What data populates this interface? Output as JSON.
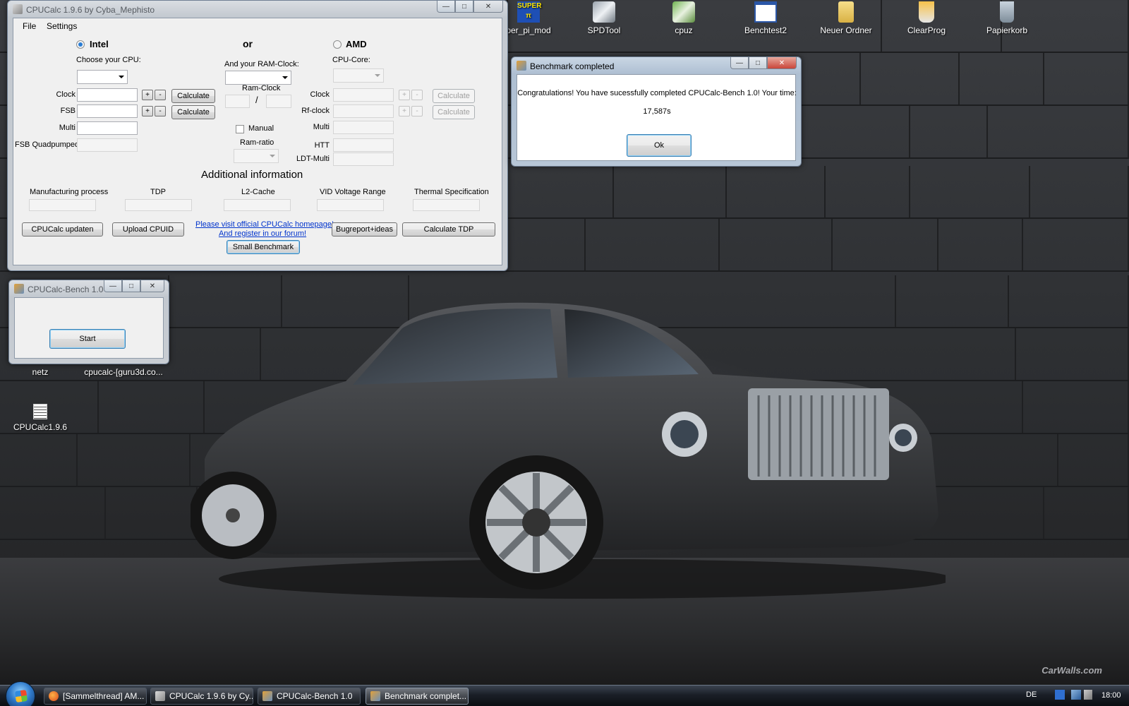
{
  "desktop": {
    "icons_top": [
      "per_pi_mod",
      "SPDTool",
      "cpuz",
      "Benchtest2",
      "Neuer Ordner",
      "ClearProg",
      "Papierkorb"
    ],
    "icons_left": [
      "netz",
      "cpucalc-[guru3d.co...",
      "CPUCalc1.9.6"
    ],
    "watermark": "CarWalls.com"
  },
  "cpucalc_window": {
    "title": "CPUCalc 1.9.6 by Cyba_Mephisto",
    "menu": [
      "File",
      "Settings"
    ],
    "intel": {
      "radio_label": "Intel",
      "choose_cpu_label": "Choose your CPU:",
      "clock_label": "Clock",
      "fsb_label": "FSB",
      "multi_label": "Multi",
      "fsb_quad_label": "FSB Quadpumped",
      "calculate_label": "Calculate",
      "plus": "+",
      "minus": "-"
    },
    "or_label": "or",
    "ram": {
      "ram_clock_prompt": "And your RAM-Clock:",
      "ram_clock_label": "Ram-Clock",
      "slash": "/",
      "manual_label": "Manual",
      "ram_ratio_label": "Ram-ratio"
    },
    "amd": {
      "radio_label": "AMD",
      "core_label": "CPU-Core:",
      "clock_label": "Clock",
      "rf_clock_label": "Rf-clock",
      "multi_label": "Multi",
      "htt_label": "HTT",
      "ldt_label": "LDT-Multi",
      "calculate_label": "Calculate"
    },
    "additional": {
      "heading": "Additional information",
      "columns": [
        "Manufacturing process",
        "TDP",
        "L2-Cache",
        "VID Voltage Range",
        "Thermal Specification"
      ]
    },
    "buttons": {
      "update": "CPUCalc updaten",
      "upload": "Upload CPUID",
      "bugreport": "Bugreport+ideas",
      "calc_tdp": "Calculate TDP",
      "small_bench": "Small Benchmark"
    },
    "links": [
      "Please visit official CPUCalc homepage!",
      "And register in our forum!"
    ]
  },
  "bench_window": {
    "title": "CPUCalc-Bench 1.0",
    "start_label": "Start"
  },
  "dialog": {
    "title": "Benchmark completed",
    "message": "Congratulations! You have sucessfully completed CPUCalc-Bench 1.0! Your time:",
    "time": "17,587s",
    "ok_label": "Ok"
  },
  "taskbar": {
    "tasks": [
      "[Sammelthread] AM...",
      "CPUCalc 1.9.6 by Cy...",
      "CPUCalc-Bench 1.0",
      "Benchmark complet..."
    ],
    "language": "DE",
    "clock": "18:00"
  },
  "caption_buttons": {
    "minimize": "—",
    "maximize": "□",
    "close": "✕"
  }
}
